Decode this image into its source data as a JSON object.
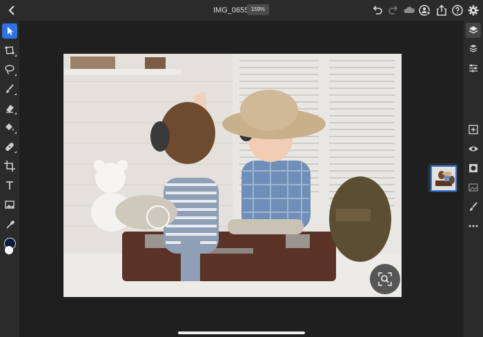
{
  "header": {
    "document_title": "IMG_0655",
    "zoom_level": "159%"
  },
  "icons": {
    "top_bar": [
      "back-chevron-icon",
      "undo-icon",
      "redo-icon",
      "cloud-icon",
      "share-user-icon",
      "export-icon",
      "help-icon",
      "settings-gear-icon"
    ],
    "left_tools": [
      "select-arrow-icon",
      "transform-icon",
      "lasso-icon",
      "brush-icon",
      "eraser-icon",
      "fill-bucket-icon",
      "healing-icon",
      "crop-icon",
      "text-icon",
      "image-icon",
      "eyedropper-icon"
    ],
    "right_tools": [
      "layers-icon",
      "layer-stack-icon",
      "adjustments-icon",
      "add-layer-icon",
      "visibility-eye-icon",
      "mask-icon",
      "image-place-icon",
      "more-options-icon"
    ]
  },
  "colors": {
    "accent": "#2f72e8",
    "foreground_color": "#0a1a3a",
    "background_color": "#ffffff"
  }
}
